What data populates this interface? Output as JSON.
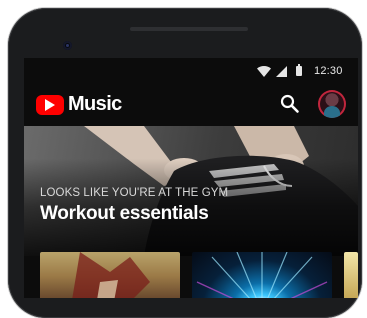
{
  "status_bar": {
    "time": "12:30"
  },
  "app_bar": {
    "logo_text": "Music",
    "brand_color": "#ff0000",
    "search_icon": "search-icon",
    "avatar_icon": "avatar"
  },
  "hero": {
    "kicker": "LOOKS LIKE YOU'RE AT THE GYM",
    "title": "Workout essentials"
  },
  "carousel": {
    "items": [
      {
        "name": "album-card-1"
      },
      {
        "name": "album-card-2"
      },
      {
        "name": "album-card-3"
      }
    ]
  }
}
